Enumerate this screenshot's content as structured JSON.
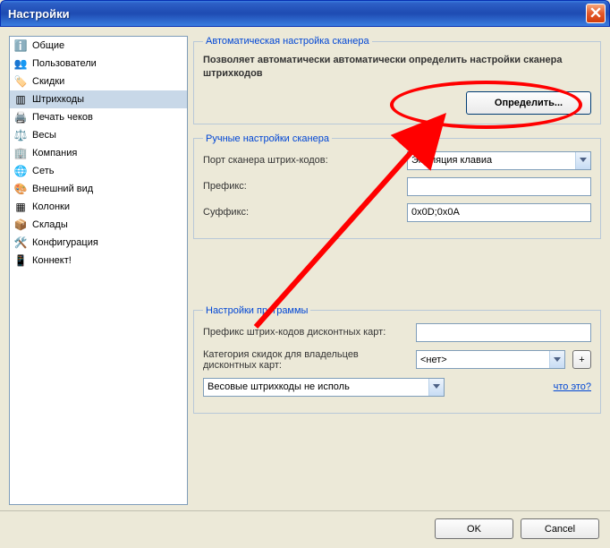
{
  "window": {
    "title": "Настройки"
  },
  "sidebar": {
    "items": [
      {
        "label": "Общие",
        "icon": "ℹ️"
      },
      {
        "label": "Пользователи",
        "icon": "👥"
      },
      {
        "label": "Скидки",
        "icon": "🏷️"
      },
      {
        "label": "Штрихкоды",
        "icon": "▥"
      },
      {
        "label": "Печать чеков",
        "icon": "🖨️"
      },
      {
        "label": "Весы",
        "icon": "⚖️"
      },
      {
        "label": "Компания",
        "icon": "🏢"
      },
      {
        "label": "Сеть",
        "icon": "🌐"
      },
      {
        "label": "Внешний вид",
        "icon": "🎨"
      },
      {
        "label": "Колонки",
        "icon": "▦"
      },
      {
        "label": "Склады",
        "icon": "📦"
      },
      {
        "label": "Конфигурация",
        "icon": "🛠️"
      },
      {
        "label": "Коннект!",
        "icon": "📱"
      }
    ]
  },
  "auto": {
    "legend": "Автоматическая настройка сканера",
    "description": "Позволяет автоматически автоматически определить настройки сканера штрихкодов",
    "detect_btn": "Определить..."
  },
  "manual": {
    "legend": "Ручные настройки сканера",
    "port_label": "Порт сканера штрих-кодов:",
    "port_value": "Эмуляция клавиа",
    "prefix_label": "Префикс:",
    "prefix_value": "",
    "suffix_label": "Суффикс:",
    "suffix_value": "0x0D;0x0A"
  },
  "program": {
    "legend": "Настройки программы",
    "disc_prefix_label": "Префикс штрих-кодов дисконтных карт:",
    "disc_prefix_value": "",
    "disc_cat_label": "Категория скидок для владельцев дисконтных карт:",
    "disc_cat_value": "<нет>",
    "weight_value": "Весовые штрихкоды не исполь",
    "what_link": "что это?",
    "plus": "+"
  },
  "buttons": {
    "ok": "OK",
    "cancel": "Cancel"
  }
}
